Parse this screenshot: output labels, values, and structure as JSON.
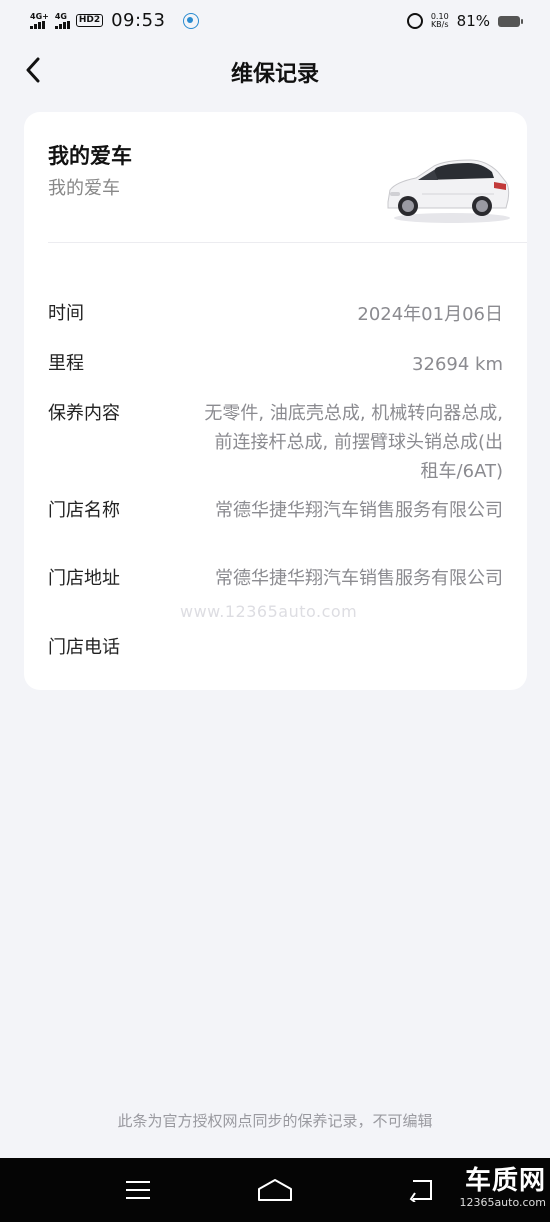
{
  "status_bar": {
    "sim1": "4G+",
    "sim2": "4G",
    "hd": "HD2",
    "time": "09:53",
    "speed_value": "0.10",
    "speed_unit": "KB/s",
    "battery": "81%"
  },
  "header": {
    "title": "维保记录"
  },
  "car": {
    "name": "我的爱车",
    "subtitle": "我的爱车"
  },
  "details": [
    {
      "label": "时间",
      "value": "2024年01月06日"
    },
    {
      "label": "里程",
      "value": "32694 km"
    },
    {
      "label": "保养内容",
      "value": "无零件, 油底壳总成, 机械转向器总成, 前连接杆总成, 前摆臂球头销总成(出租车/6AT)"
    },
    {
      "label": "门店名称",
      "value": "常德华捷华翔汽车销售服务有限公司"
    },
    {
      "label": "门店地址",
      "value": "常德华捷华翔汽车销售服务有限公司"
    },
    {
      "label": "门店电话",
      "value": ""
    }
  ],
  "watermark": "www.12365auto.com",
  "footer_note": "此条为官方授权网点同步的保养记录，不可编辑",
  "logo": {
    "main": "车质网",
    "sub": "12365auto.com"
  },
  "colors": {
    "background": "#f3f4f8",
    "card": "#ffffff",
    "value_text": "#8b8b90",
    "navbar": "#050505",
    "logo_accent": "#e8313a"
  },
  "icons": [
    "back-arrow-icon",
    "menu-icon",
    "home-icon",
    "back-nav-icon",
    "alarm-icon",
    "battery-icon"
  ]
}
